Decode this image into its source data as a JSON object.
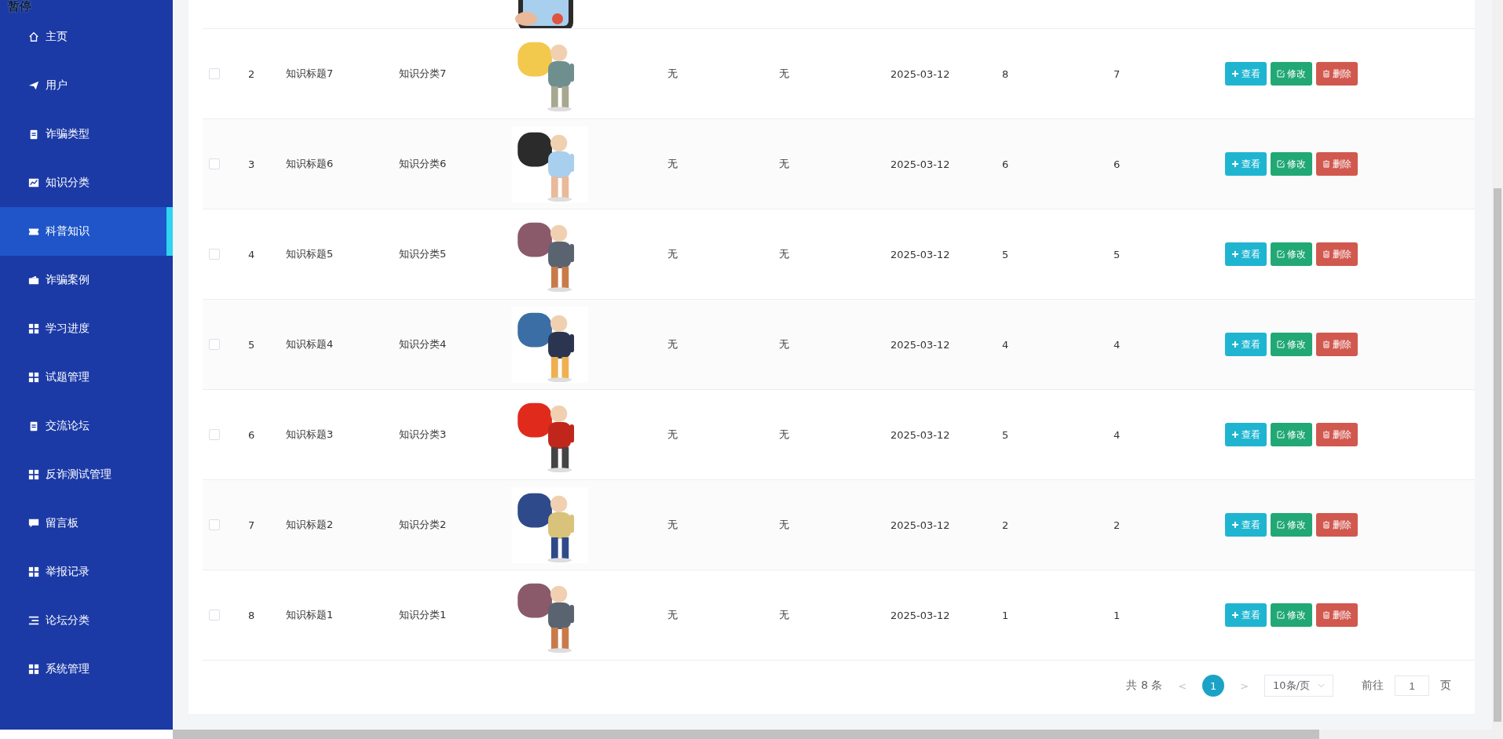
{
  "overlay_label": "暂停",
  "sidebar": {
    "items": [
      {
        "label": "主页",
        "selected": false
      },
      {
        "label": "用户",
        "selected": false
      },
      {
        "label": "诈骗类型",
        "selected": false
      },
      {
        "label": "知识分类",
        "selected": false
      },
      {
        "label": "科普知识",
        "selected": true
      },
      {
        "label": "诈骗案例",
        "selected": false
      },
      {
        "label": "学习进度",
        "selected": false
      },
      {
        "label": "试题管理",
        "selected": false
      },
      {
        "label": "交流论坛",
        "selected": false
      },
      {
        "label": "反诈测试管理",
        "selected": false
      },
      {
        "label": "留言板",
        "selected": false
      },
      {
        "label": "举报记录",
        "selected": false
      },
      {
        "label": "论坛分类",
        "selected": false
      },
      {
        "label": "系统管理",
        "selected": false
      }
    ]
  },
  "table": {
    "rows": [
      {
        "index": "2",
        "title": "知识标题7",
        "category": "知识分类7",
        "column_6": "无",
        "column_7": "无",
        "date": "2025-03-12",
        "column_9": "8",
        "column_10": "7",
        "checked": false,
        "actions": [
          {
            "kind": "view",
            "label": "查看"
          },
          {
            "kind": "edit",
            "label": "修改"
          },
          {
            "kind": "delete",
            "label": "删除"
          }
        ]
      },
      {
        "index": "3",
        "title": "知识标题6",
        "category": "知识分类6",
        "column_6": "无",
        "column_7": "无",
        "date": "2025-03-12",
        "column_9": "6",
        "column_10": "6",
        "checked": false,
        "actions": [
          {
            "kind": "view",
            "label": "查看"
          },
          {
            "kind": "edit",
            "label": "修改"
          },
          {
            "kind": "delete",
            "label": "删除"
          }
        ]
      },
      {
        "index": "4",
        "title": "知识标题5",
        "category": "知识分类5",
        "column_6": "无",
        "column_7": "无",
        "date": "2025-03-12",
        "column_9": "5",
        "column_10": "5",
        "checked": false,
        "actions": [
          {
            "kind": "view",
            "label": "查看"
          },
          {
            "kind": "edit",
            "label": "修改"
          },
          {
            "kind": "delete",
            "label": "删除"
          }
        ]
      },
      {
        "index": "5",
        "title": "知识标题4",
        "category": "知识分类4",
        "column_6": "无",
        "column_7": "无",
        "date": "2025-03-12",
        "column_9": "4",
        "column_10": "4",
        "checked": false,
        "actions": [
          {
            "kind": "view",
            "label": "查看"
          },
          {
            "kind": "edit",
            "label": "修改"
          },
          {
            "kind": "delete",
            "label": "删除"
          }
        ]
      },
      {
        "index": "6",
        "title": "知识标题3",
        "category": "知识分类3",
        "column_6": "无",
        "column_7": "无",
        "date": "2025-03-12",
        "column_9": "5",
        "column_10": "4",
        "checked": false,
        "actions": [
          {
            "kind": "view",
            "label": "查看"
          },
          {
            "kind": "edit",
            "label": "修改"
          },
          {
            "kind": "delete",
            "label": "删除"
          }
        ]
      },
      {
        "index": "7",
        "title": "知识标题2",
        "category": "知识分类2",
        "column_6": "无",
        "column_7": "无",
        "date": "2025-03-12",
        "column_9": "2",
        "column_10": "2",
        "checked": false,
        "actions": [
          {
            "kind": "view",
            "label": "查看"
          },
          {
            "kind": "edit",
            "label": "修改"
          },
          {
            "kind": "delete",
            "label": "删除"
          }
        ]
      },
      {
        "index": "8",
        "title": "知识标题1",
        "category": "知识分类1",
        "column_6": "无",
        "column_7": "无",
        "date": "2025-03-12",
        "column_9": "1",
        "column_10": "1",
        "checked": false,
        "actions": [
          {
            "kind": "view",
            "label": "查看"
          },
          {
            "kind": "edit",
            "label": "修改"
          },
          {
            "kind": "delete",
            "label": "删除"
          }
        ]
      }
    ]
  },
  "pagination": {
    "total": "共 8 条",
    "prev": "<",
    "pages": [
      {
        "label": "1",
        "selected": true
      }
    ],
    "next": ">",
    "page_size": "10条/页",
    "goto_label": "前往",
    "goto_value": "1",
    "goto_suffix": "页"
  }
}
